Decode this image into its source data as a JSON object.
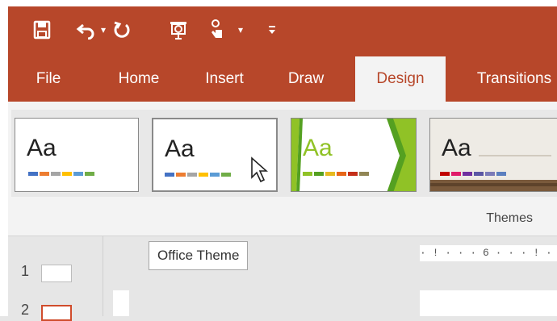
{
  "quick_access_toolbar": {
    "icons": [
      "save-icon",
      "undo-icon",
      "dropdown-arrow-icon",
      "redo-icon",
      "start-from-beginning-icon",
      "touch-mouse-mode-icon",
      "dropdown-arrow-icon",
      "customize-toolbar-icon"
    ]
  },
  "ribbon": {
    "tabs": [
      {
        "label": "File"
      },
      {
        "label": "Home"
      },
      {
        "label": "Insert"
      },
      {
        "label": "Draw"
      },
      {
        "label": "Design",
        "active": true
      },
      {
        "label": "Transitions"
      }
    ],
    "themes_group": {
      "label": "Themes",
      "items": [
        {
          "sample_text": "Aa",
          "name": "Office Theme"
        },
        {
          "sample_text": "Aa",
          "name": "Office Theme",
          "hovered": true
        },
        {
          "sample_text": "Aa"
        },
        {
          "sample_text": "Aa"
        }
      ]
    }
  },
  "tooltip": {
    "text": "Office Theme"
  },
  "ruler": {
    "text": "· ! · · · 6 · · · ! ·"
  },
  "slides": [
    {
      "number": "1"
    },
    {
      "number": "2"
    }
  ],
  "colors": {
    "accent": "#b7472a",
    "ribbon_bg": "#f3f3f3",
    "office_swatches": [
      "#4472c4",
      "#ed7d31",
      "#a5a5a5",
      "#ffc000",
      "#5b9bd5",
      "#70ad47"
    ],
    "facet_swatches": [
      "#90c226",
      "#54a021",
      "#e6b91e",
      "#e76618",
      "#c42f1a",
      "#918655"
    ],
    "theme4_swatches": [
      "#c00000",
      "#e01b6a",
      "#7030a0",
      "#5b57a4",
      "#7b7bb8",
      "#5b7fbf"
    ]
  }
}
